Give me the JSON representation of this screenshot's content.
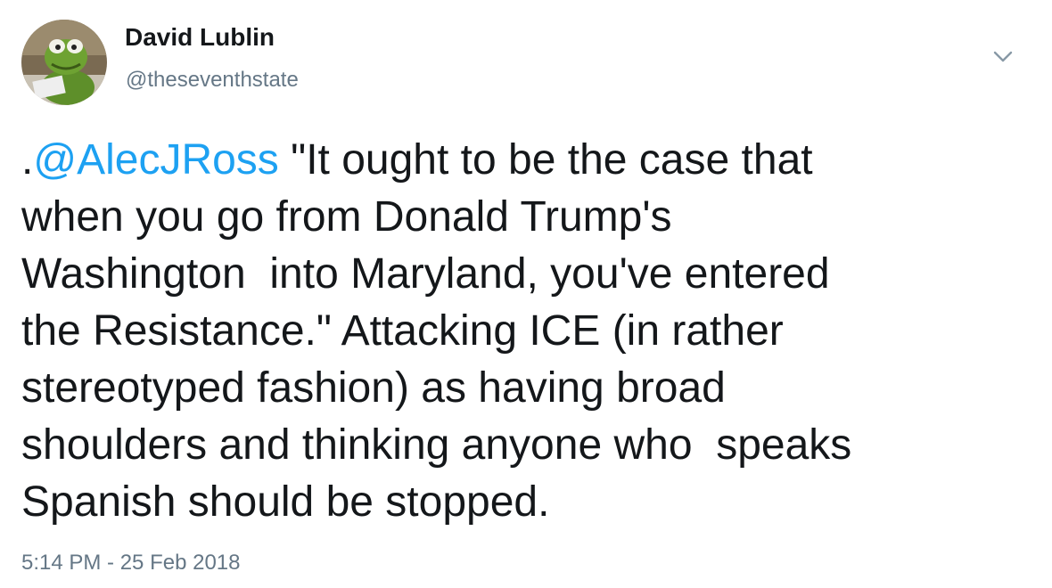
{
  "author": {
    "display_name": "David Lublin",
    "handle": "@theseventhstate",
    "avatar_icon": "kermit-avatar"
  },
  "menu": {
    "icon": "chevron-down-icon"
  },
  "tweet": {
    "prefix": ".",
    "mention": "@AlecJRoss",
    "text": " \"It ought to be the case that\nwhen you go from Donald Trump's\nWashington  into Maryland, you've entered\nthe Resistance.\" Attacking ICE (in rather\nstereotyped fashion) as having broad\nshoulders and thinking anyone who  speaks\nSpanish should be stopped.",
    "timestamp": "5:14 PM - 25 Feb 2018"
  },
  "colors": {
    "link": "#1da1f2",
    "text": "#14171a",
    "secondary": "#657786"
  }
}
